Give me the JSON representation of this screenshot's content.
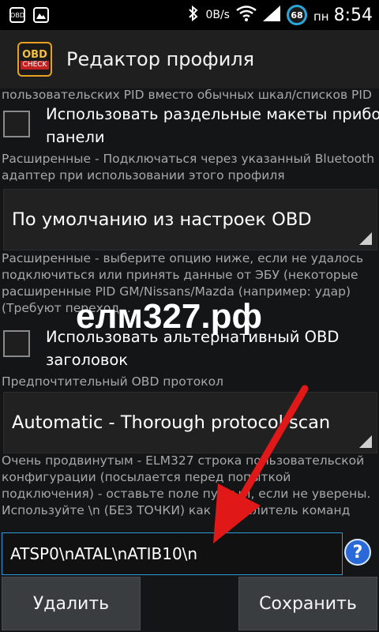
{
  "status_bar": {
    "left_icons": [
      "obd-notification-icon",
      "gallery-notification-icon"
    ],
    "obd_mini_label": "OBD",
    "speed": "0B/s",
    "battery": "68",
    "day": "пн",
    "time": "8:54"
  },
  "app_bar": {
    "icon_top": "OBD",
    "icon_bottom": "CHECK",
    "title": "Редактор профиля"
  },
  "content": {
    "desc_top": "пользовательских PID вместо обычных шкал/списков PID",
    "checkbox1": {
      "line1": "Использовать раздельные макеты приборной",
      "line2": "панели"
    },
    "desc_bt": [
      "Расширенные - Подключаться через указанный Bluetooth",
      "адаптер при использовании этого профиля"
    ],
    "spinner_bt": "По умолчанию из настроек OBD",
    "desc_header": [
      "Расширенные - выберите опцию ниже, если не удалось",
      "подключиться или принять данные от ЭБУ (некоторые",
      "расширенные PID GM/Nissans/Mazda (например: удар)",
      "(Требуют переход..."
    ],
    "checkbox2": {
      "line1": "Использовать альтернативный OBD",
      "line2": "заголовок"
    },
    "desc_protocol": "Предпочтительный OBD протокол",
    "spinner_protocol": "Automatic - Thorough protocol scan",
    "desc_init": [
      "Очень продвинутым - ELM327 строка пользовательской",
      "конфигурации (посылается перед попыткой",
      "подключения) - оставьте поле пустым, если не уверены.",
      "Используйте \\n (БЕЗ ТОЧКИ) как разделитель команд"
    ],
    "init_value": "ATSP0\\nATAL\\nATIB10\\n",
    "help_symbol": "?",
    "watermark": "елм327.рф"
  },
  "buttons": {
    "delete": "Удалить",
    "save": "Сохранить"
  },
  "colors": {
    "accent": "#2e9bd8",
    "arrow": "#e01818",
    "background": "#141516"
  }
}
